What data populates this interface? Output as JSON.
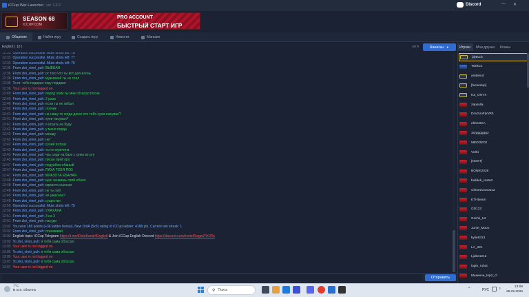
{
  "window": {
    "title": "iCCup War Launcher",
    "version": "ver. 1.3.9"
  },
  "discord_label": "Discord",
  "banners": {
    "season": {
      "line1": "SEASON 68",
      "line2": "ICCUP.COM"
    },
    "pro": {
      "line1": "PRO ACCOUNT",
      "line2": "БЫСТРЫЙ СТАРТ ИГР"
    }
  },
  "nav_tabs": [
    "Общение",
    "Найти игру",
    "Создать игру",
    "Новости",
    "Магазин"
  ],
  "chat_header": {
    "language": "English ( 10 )",
    "font_control": "aA A",
    "channels_button": "Каналы"
  },
  "player_tabs": [
    "Игроки",
    "Мои друзья",
    "Кланы"
  ],
  "messages": [
    {
      "ts": "12:33",
      "parts": [
        {
          "t": "Operation successful. Mute shots left: 78",
          "c": "blue"
        }
      ]
    },
    {
      "ts": "12:33",
      "parts": [
        {
          "t": "Operation successful. Mute shots left: 77",
          "c": "blue"
        }
      ]
    },
    {
      "ts": "12:33",
      "parts": [
        {
          "t": "Operation successful. Mute shots left: 76",
          "c": "blue"
        }
      ]
    },
    {
      "ts": "12:36",
      "parts": [
        {
          "t": "From zloi_vinni_puh:",
          "c": "blue"
        },
        {
          "t": " ВЫЕБАН",
          "c": "green"
        }
      ]
    },
    {
      "ts": "12:36",
      "parts": [
        {
          "t": "From zloi_vinni_puh:",
          "c": "blue"
        },
        {
          "t": " от того что ты вот дал ёлочь",
          "c": "green"
        }
      ]
    },
    {
      "ts": "12:36",
      "parts": [
        {
          "t": "From zloi_vinni_puh:",
          "c": "blue"
        },
        {
          "t": " мужчиной ты не стал",
          "c": "green"
        }
      ]
    },
    {
      "ts": "12:36",
      "parts": [
        {
          "t": "To m:",
          "c": "blue"
        },
        {
          "t": " тебя подарил игру подарил",
          "c": "green"
        }
      ]
    },
    {
      "ts": "12:36",
      "parts": [
        {
          "t": "Your user is not logged on.",
          "c": "red"
        }
      ]
    },
    {
      "ts": "12:40",
      "parts": [
        {
          "t": "From zloi_vinni_puh:",
          "c": "blue"
        },
        {
          "t": " перед этим ты мне отсасал посни",
          "c": "green"
        }
      ]
    },
    {
      "ts": "12:40",
      "parts": [
        {
          "t": "From zloi_vinni_puh:",
          "c": "blue"
        },
        {
          "t": " 2 раза",
          "c": "green"
        }
      ]
    },
    {
      "ts": "12:40",
      "parts": [
        {
          "t": "From zloi_vinni_puh:",
          "c": "blue"
        },
        {
          "t": " если ты не забыл",
          "c": "green"
        }
      ]
    },
    {
      "ts": "12:40",
      "parts": [
        {
          "t": "From zloi_vinni_puh:",
          "c": "blue"
        },
        {
          "t": " лохчик",
          "c": "green"
        }
      ]
    },
    {
      "ts": "12:41",
      "parts": [
        {
          "t": "From zloi_vinni_puh:",
          "c": "blue"
        },
        {
          "t": " на нашу то когда денег кто тебя хуем насувал?",
          "c": "green"
        }
      ]
    },
    {
      "ts": "12:41",
      "parts": [
        {
          "t": "From zloi_vinni_puh:",
          "c": "blue"
        },
        {
          "t": " хуев насувал?",
          "c": "green"
        }
      ]
    },
    {
      "ts": "12:41",
      "parts": [
        {
          "t": "From zloi_vinni_puh:",
          "c": "blue"
        },
        {
          "t": " я играть не буду",
          "c": "green"
        }
      ]
    },
    {
      "ts": "12:42",
      "parts": [
        {
          "t": "From zloi_vinni_puh:",
          "c": "blue"
        },
        {
          "t": " у меня перда",
          "c": "green"
        }
      ]
    },
    {
      "ts": "12:42",
      "parts": [
        {
          "t": "From zloi_vinni_puh:",
          "c": "blue"
        },
        {
          "t": " между",
          "c": "green"
        }
      ]
    },
    {
      "ts": "12:42",
      "parts": [
        {
          "t": "From zloi_vinni_puh:",
          "c": "blue"
        },
        {
          "t": " нет",
          "c": "green"
        }
      ]
    },
    {
      "ts": "12:42",
      "parts": [
        {
          "t": "From zloi_vinni_puh:",
          "c": "blue"
        },
        {
          "t": " сучий потрах",
          "c": "green"
        }
      ]
    },
    {
      "ts": "12:43",
      "parts": [
        {
          "t": "From zloi_vinni_puh:",
          "c": "blue"
        },
        {
          "t": " ты не мужчина",
          "c": "green"
        }
      ]
    },
    {
      "ts": "12:43",
      "parts": [
        {
          "t": "From zloi_vinni_puh:",
          "c": "blue"
        },
        {
          "t": " чрь сиди на базе с хуем во рту",
          "c": "green"
        }
      ]
    },
    {
      "ts": "12:43",
      "parts": [
        {
          "t": "From zloi_vinni_puh:",
          "c": "blue"
        },
        {
          "t": " писан прей про",
          "c": "green"
        }
      ]
    },
    {
      "ts": "12:47",
      "parts": [
        {
          "t": "From zloi_vinni_puh:",
          "c": "blue"
        },
        {
          "t": " подуабом ебаный",
          "c": "green"
        }
      ]
    },
    {
      "ts": "12:47",
      "parts": [
        {
          "t": "From zloi_vinni_puh:",
          "c": "blue"
        },
        {
          "t": " ПАХА ТЕБЯ ПОХ",
          "c": "green"
        }
      ]
    },
    {
      "ts": "12:47",
      "parts": [
        {
          "t": "From zloi_vinni_puh:",
          "c": "blue"
        },
        {
          "t": " МРАЗОТА ЕБАНАЯ",
          "c": "green"
        }
      ]
    },
    {
      "ts": "12:48",
      "parts": [
        {
          "t": "From zloi_vinni_puh:",
          "c": "blue"
        },
        {
          "t": " щас ченвишь свой ебало",
          "c": "green"
        }
      ]
    },
    {
      "ts": "12:48",
      "parts": [
        {
          "t": "From zloi_vinni_puh:",
          "c": "blue"
        },
        {
          "t": " мразота ешеная",
          "c": "green"
        }
      ]
    },
    {
      "ts": "12:48",
      "parts": [
        {
          "t": "From zloi_vinni_puh:",
          "c": "blue"
        },
        {
          "t": " не ты хуй",
          "c": "green"
        }
      ]
    },
    {
      "ts": "12:49",
      "parts": [
        {
          "t": "From zloi_vinni_puh:",
          "c": "blue"
        },
        {
          "t": " чё ужасное?",
          "c": "green"
        }
      ]
    },
    {
      "ts": "12:49",
      "parts": [
        {
          "t": "From zloi_vinni_puh:",
          "c": "blue"
        },
        {
          "t": " существо",
          "c": "green"
        }
      ]
    },
    {
      "ts": "12:50",
      "parts": [
        {
          "t": "Operation successful. Mute shots left: 75",
          "c": "blue"
        }
      ]
    },
    {
      "ts": "12:50",
      "parts": [
        {
          "t": "From zloi_vinni_puh:",
          "c": "blue"
        },
        {
          "t": " УХАХАХА",
          "c": "green"
        }
      ]
    },
    {
      "ts": "12:51",
      "parts": [
        {
          "t": "From zloi_vinni_puh:",
          "c": "blue"
        },
        {
          "t": " 3 на 3",
          "c": "green"
        }
      ]
    },
    {
      "ts": "12:51",
      "parts": [
        {
          "t": "From zloi_vinni_puh:",
          "c": "blue"
        },
        {
          "t": " пасуди",
          "c": "green"
        }
      ]
    },
    {
      "ts": "13:02",
      "parts": [
        {
          "t": "You won 186 points (+36 ladder bonus). New DotA (5x5) rating of iCCup ladder: 4188 pts. Current win streak: 1",
          "c": "blue"
        }
      ]
    },
    {
      "ts": "13:02",
      "parts": [
        {
          "t": "From zloi_vinni_puh:",
          "c": "blue"
        },
        {
          "t": " отшикивай",
          "c": "green"
        }
      ]
    },
    {
      "ts": "13:03",
      "parts": [
        {
          "t": "English topic: iCCup Telegram ",
          "c": "white"
        },
        {
          "t": "https://t.me/iDotaKanal#English",
          "c": "link"
        },
        {
          "t": " & Join iCCup English Discord ",
          "c": "white"
        },
        {
          "t": "https://discord.com/invite/MagwZYrDRc",
          "c": "link"
        }
      ]
    },
    {
      "ts": "13:03",
      "parts": [
        {
          "t": "To zloi_vinni_puh:",
          "c": "blue"
        },
        {
          "t": " я тебя сама обоссал",
          "c": "green"
        }
      ]
    },
    {
      "ts": "13:03",
      "parts": [
        {
          "t": "Your user is not logged on.",
          "c": "red"
        }
      ]
    },
    {
      "ts": "13:05",
      "parts": [
        {
          "t": "To zloi_vinni_puh:",
          "c": "blue"
        },
        {
          "t": " я тебя сама обоссал",
          "c": "green"
        }
      ]
    },
    {
      "ts": "13:05",
      "parts": [
        {
          "t": "Your user is not logged on.",
          "c": "red"
        }
      ]
    },
    {
      "ts": "13:07",
      "parts": [
        {
          "t": "To zloi_vinni_puh:",
          "c": "blue"
        },
        {
          "t": " я тебя сама обоссал",
          "c": "green"
        }
      ]
    },
    {
      "ts": "13:07",
      "parts": [
        {
          "t": "Your user is not logged on.",
          "c": "red"
        }
      ]
    }
  ],
  "chat_input": {
    "value": "",
    "placeholder": ""
  },
  "send_button": "Отправить",
  "players": [
    {
      "name": "[3]Buck",
      "flag": "dark"
    },
    {
      "name": "Tsleko1",
      "flag": "blue"
    },
    {
      "name": "ambiend",
      "flag": "dark"
    },
    {
      "name": "[fuckedup]",
      "flag": "dark"
    },
    {
      "name": "KZ_ONYX",
      "flag": "dark"
    },
    {
      "name": "zapsulla",
      "flag": "red"
    },
    {
      "name": "DraGonFlyVR5",
      "flag": "red"
    },
    {
      "name": "ekbCSKA",
      "flag": "red"
    },
    {
      "name": "3urgggggg2",
      "flag": "red"
    },
    {
      "name": "MEDOEDz",
      "flag": "red"
    },
    {
      "name": "VolKi",
      "flag": "red"
    },
    {
      "name": "[NOXT]",
      "flag": "red"
    },
    {
      "name": "BONiK2026",
      "flag": "red"
    },
    {
      "name": "bulldek_restart",
      "flag": "red"
    },
    {
      "name": "Chinezuvocat13",
      "flag": "red"
    },
    {
      "name": "ETHbeam",
      "flag": "red"
    },
    {
      "name": "GD123",
      "flag": "red"
    },
    {
      "name": "Grehk_tut",
      "flag": "red"
    },
    {
      "name": "Jume_Moon",
      "flag": "red"
    },
    {
      "name": "kylie6313",
      "flag": "red"
    },
    {
      "name": "LA_321",
      "flag": "red"
    },
    {
      "name": "Ljube1212",
      "flag": "red"
    },
    {
      "name": "login_robot",
      "flag": "red"
    },
    {
      "name": "Макинчи_top2_cf",
      "flag": "red"
    }
  ],
  "taskbar": {
    "weather_temp": "7°C",
    "weather_desc": "В осн. облачно",
    "search_placeholder": "Поиск",
    "tray_lang": "РУС",
    "time": "13:09",
    "date": "28.09.2026"
  },
  "colors": {
    "accent": "#2f6bd1",
    "bg": "#1a2233",
    "system_msg": "#6fa8ff",
    "private_msg": "#3bd15a",
    "error": "#ff5050"
  }
}
